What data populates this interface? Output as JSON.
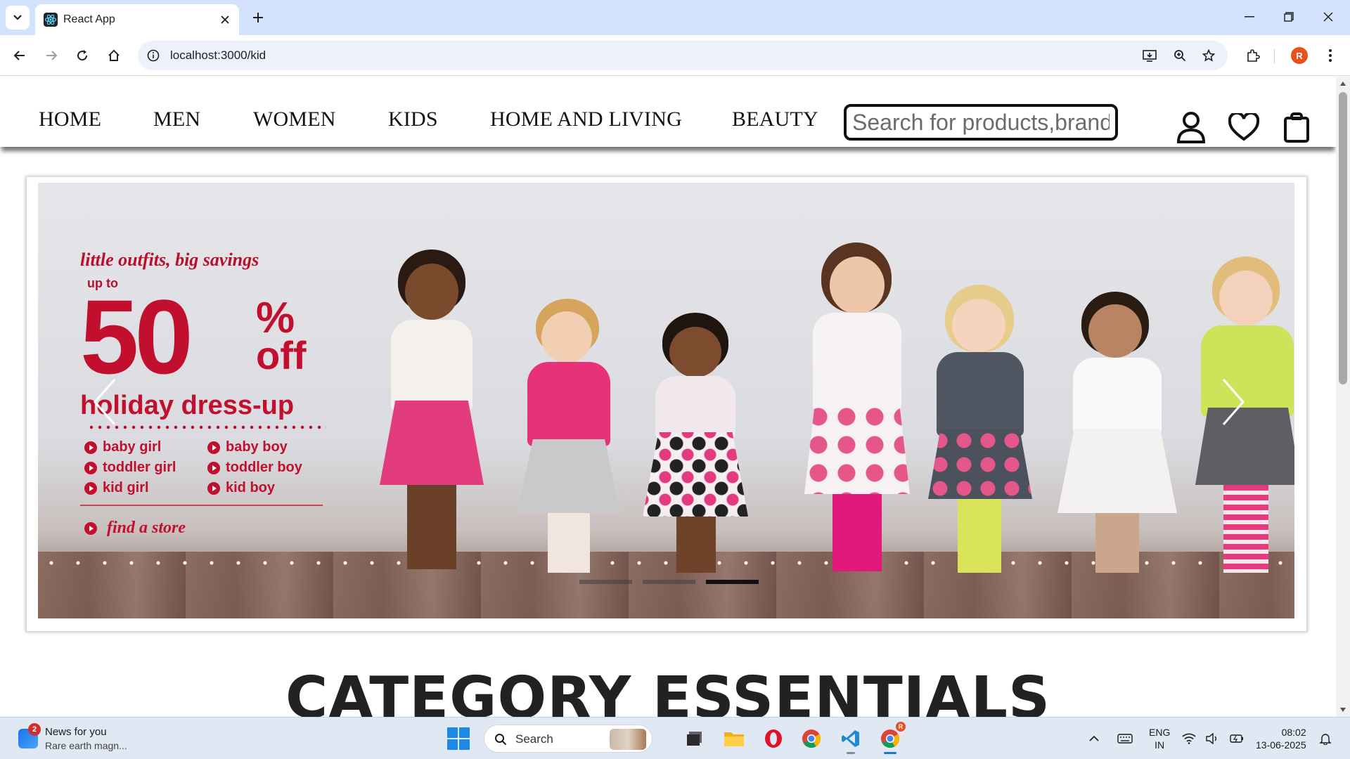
{
  "browser": {
    "tab_title": "React App",
    "url": "localhost:3000/kid",
    "profile_initial": "R"
  },
  "site": {
    "nav": [
      "HOME",
      "MEN",
      "WOMEN",
      "KIDS",
      "HOME AND LIVING",
      "BEAUTY"
    ],
    "search_placeholder": "Search for products,brands",
    "icons": [
      "profile-icon",
      "wishlist-heart-icon",
      "shopping-bag-icon"
    ]
  },
  "banner": {
    "tagline": "little outfits, big savings",
    "up_to": "up to",
    "discount_number": "50",
    "discount_percent": "%",
    "discount_off": "off",
    "subtitle": "holiday dress-up",
    "categories": [
      "baby girl",
      "baby boy",
      "toddler girl",
      "toddler boy",
      "kid girl",
      "kid boy"
    ],
    "cta": "find a store",
    "slide_count": 3,
    "active_slide": 3
  },
  "section": {
    "title": "CATEGORY ESSENTIALS"
  },
  "taskbar": {
    "news_title": "News for you",
    "news_subtitle": "Rare earth magn...",
    "news_badge": "2",
    "search_label": "Search",
    "lang_line1": "ENG",
    "lang_line2": "IN",
    "time": "08:02",
    "date": "13-06-2025",
    "chrome_badge": "R"
  },
  "colors": {
    "promo_red": "#c10f2d",
    "tabstrip": "#d3e3fd",
    "taskbar": "#dfe8f3"
  }
}
